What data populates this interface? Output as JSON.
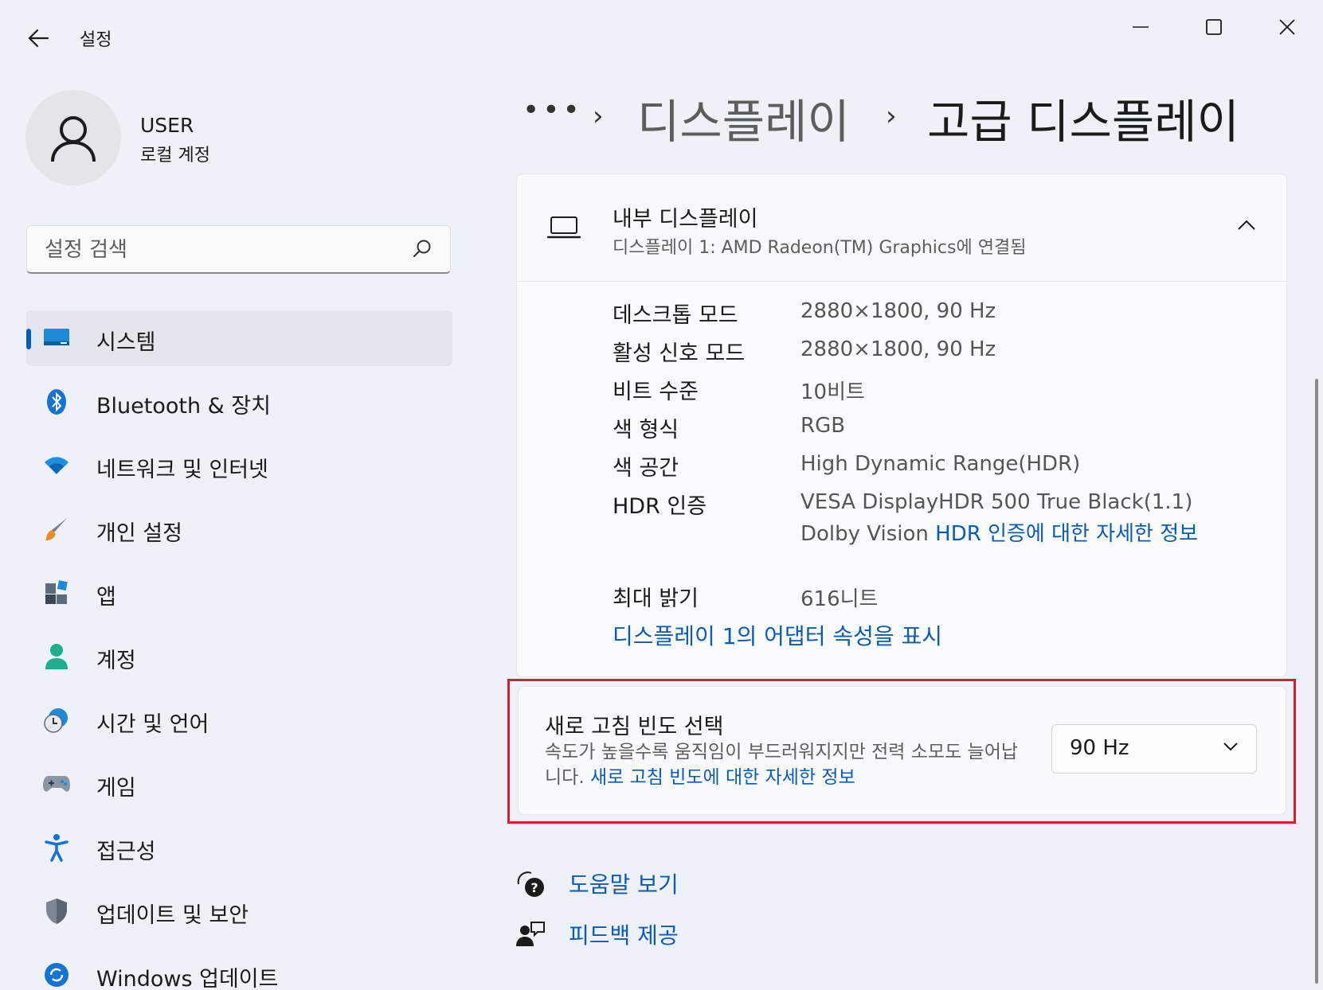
{
  "window": {
    "title": "설정",
    "accent_color": "#005fb8",
    "link_color": "#0a5bb8",
    "highlight_color": "#d81e2a"
  },
  "profile": {
    "name": "USER",
    "account_type": "로컬 계정"
  },
  "search": {
    "placeholder": "설정 검색"
  },
  "sidebar": {
    "items": [
      {
        "label": "시스템",
        "icon": "monitor-icon",
        "selected": true
      },
      {
        "label": "Bluetooth & 장치",
        "icon": "bluetooth-icon"
      },
      {
        "label": "네트워크 및 인터넷",
        "icon": "wifi-icon"
      },
      {
        "label": "개인 설정",
        "icon": "paintbrush-icon"
      },
      {
        "label": "앱",
        "icon": "apps-icon"
      },
      {
        "label": "계정",
        "icon": "account-icon"
      },
      {
        "label": "시간 및 언어",
        "icon": "clock-globe-icon"
      },
      {
        "label": "게임",
        "icon": "gamepad-icon"
      },
      {
        "label": "접근성",
        "icon": "accessibility-icon"
      },
      {
        "label": "업데이트 및 보안",
        "icon": "shield-icon"
      },
      {
        "label": "Windows 업데이트",
        "icon": "windows-update-icon"
      }
    ]
  },
  "breadcrumb": {
    "overflow": "•••",
    "separator": "›",
    "parent": "디스플레이",
    "current": "고급 디스플레이"
  },
  "display_card": {
    "title": "내부 디스플레이",
    "subtitle": "디스플레이 1: AMD Radeon(TM) Graphics에 연결됨",
    "properties": [
      {
        "label": "데스크톱 모드",
        "value": "2880×1800, 90 Hz"
      },
      {
        "label": "활성 신호 모드",
        "value": "2880×1800, 90 Hz"
      },
      {
        "label": "비트 수준",
        "value": "10비트"
      },
      {
        "label": "색 형식",
        "value": "RGB"
      },
      {
        "label": "색 공간",
        "value": "High Dynamic Range(HDR)"
      },
      {
        "label": "HDR 인증",
        "value": "VESA DisplayHDR 500 True Black(1.1)"
      }
    ],
    "hdr_extra_text": "Dolby Vision",
    "hdr_link": "HDR 인증에 대한 자세한 정보",
    "max_brightness_label": "최대 밝기",
    "max_brightness_value": "616니트",
    "adapter_link": "디스플레이 1의 어댑터 속성을 표시"
  },
  "refresh_rate": {
    "title": "새로 고침 빈도 선택",
    "description": "속도가 높을수록 움직임이 부드러워지지만 전력 소모도 늘어납니다.",
    "link": "새로 고침 빈도에 대한 자세한 정보",
    "selected_value": "90 Hz"
  },
  "footer": {
    "help_label": "도움말 보기",
    "feedback_label": "피드백 제공"
  }
}
